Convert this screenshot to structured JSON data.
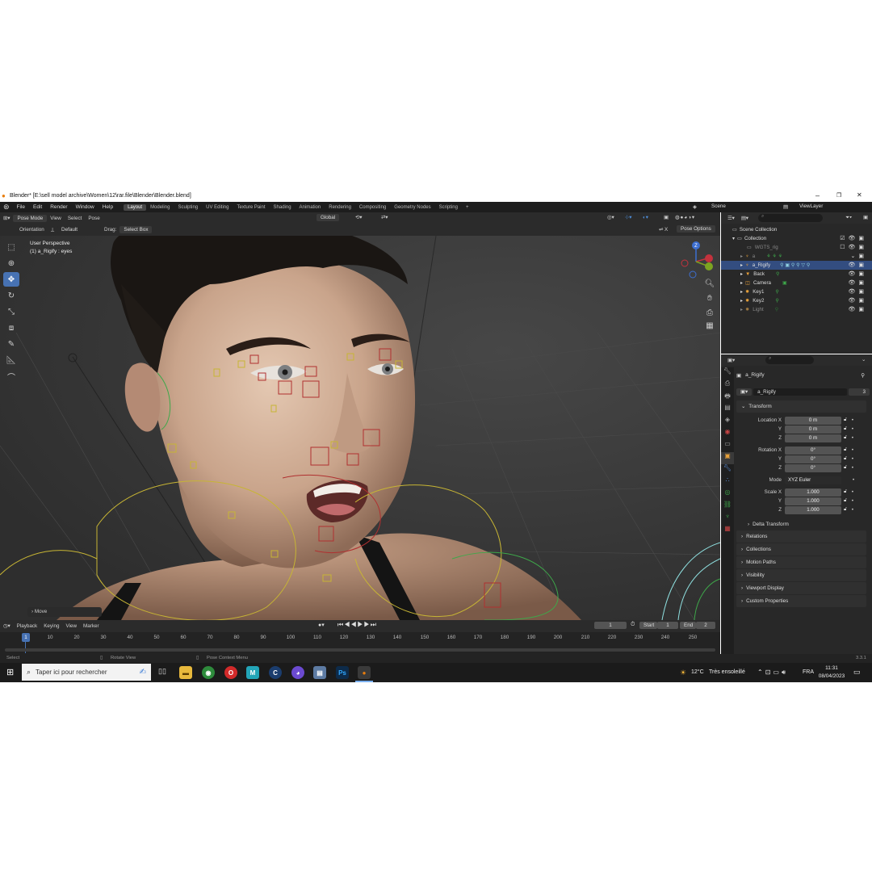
{
  "window": {
    "title": "Blender* [E:\\sell model archive\\Women\\12\\rar.file\\Blender\\Blender.blend]",
    "minimize": "–",
    "maximize": "❐",
    "close": "✕"
  },
  "menu": [
    "File",
    "Edit",
    "Render",
    "Window",
    "Help"
  ],
  "workspaces": [
    "Layout",
    "Modeling",
    "Sculpting",
    "UV Editing",
    "Texture Paint",
    "Shading",
    "Animation",
    "Rendering",
    "Compositing",
    "Geometry Nodes",
    "Scripting"
  ],
  "workspace_add": "+",
  "scene": "Scene",
  "view_layer": "ViewLayer",
  "viewport_header": {
    "mode": "Pose Mode",
    "view": "View",
    "select": "Select",
    "pose": "Pose",
    "transform": "Global",
    "pose_options": "Pose Options"
  },
  "tool_settings": {
    "orientation_label": "Orientation",
    "orientation_value": "Default",
    "drag_label": "Drag:",
    "drag_value": "Select Box"
  },
  "overlay_text": {
    "line1": "User Perspective",
    "line2": "(1) a_Rigify : eyes"
  },
  "last_op": "Move",
  "gizmo": {
    "z": "Z",
    "y": "Y",
    "x": "X"
  },
  "timeline": {
    "playback": "Playback",
    "keying": "Keying",
    "view": "View",
    "marker": "Marker",
    "current_frame": "1",
    "start_label": "Start",
    "start": "1",
    "end_label": "End",
    "end": "2",
    "ticks": [
      "1",
      "10",
      "20",
      "30",
      "40",
      "50",
      "60",
      "70",
      "80",
      "90",
      "100",
      "110",
      "120",
      "130",
      "140",
      "150",
      "160",
      "170",
      "180",
      "190",
      "200",
      "210",
      "220",
      "230",
      "240",
      "250"
    ]
  },
  "status": {
    "select": "Select",
    "rotate": "Rotate View",
    "context": "Pose Context Menu",
    "version": "3.3.1"
  },
  "outliner": {
    "root": "Scene Collection",
    "collection": "Collection",
    "items": [
      {
        "name": "WGTS_rig",
        "dim": true,
        "sel": false
      },
      {
        "name": "a",
        "dim": true,
        "sel": false
      },
      {
        "name": "a_Rigify",
        "dim": false,
        "sel": true
      },
      {
        "name": "Back",
        "dim": false,
        "sel": false
      },
      {
        "name": "Camera",
        "dim": false,
        "sel": false
      },
      {
        "name": "Key1",
        "dim": false,
        "sel": false
      },
      {
        "name": "Key2",
        "dim": false,
        "sel": false
      },
      {
        "name": "Light",
        "dim": true,
        "sel": false
      }
    ]
  },
  "properties": {
    "object_name": "a_Rigify",
    "data_name": "a_Rigify",
    "users": "3",
    "transform_label": "Transform",
    "location": {
      "label": "Location X",
      "y": "Y",
      "z": "Z",
      "values": [
        "0 m",
        "0 m",
        "0 m"
      ]
    },
    "rotation": {
      "label": "Rotation X",
      "y": "Y",
      "z": "Z",
      "values": [
        "0°",
        "0°",
        "0°"
      ]
    },
    "mode_label": "Mode",
    "mode_value": "XYZ Euler",
    "scale": {
      "label": "Scale X",
      "y": "Y",
      "z": "Z",
      "values": [
        "1.000",
        "1.000",
        "1.000"
      ]
    },
    "delta": "Delta Transform",
    "sections": [
      "Relations",
      "Collections",
      "Motion Paths",
      "Visibility",
      "Viewport Display",
      "Custom Properties"
    ]
  },
  "taskbar": {
    "search_placeholder": "Taper ici pour rechercher",
    "weather_temp": "12°C",
    "weather_text": "Très ensoleillé",
    "lang": "FRA",
    "time": "11:31",
    "date": "08/04/2023"
  },
  "colors": {
    "accent": "#4772b3",
    "selected_row": "#334d80",
    "header": "#2b2b2b",
    "panel": "#282828"
  }
}
